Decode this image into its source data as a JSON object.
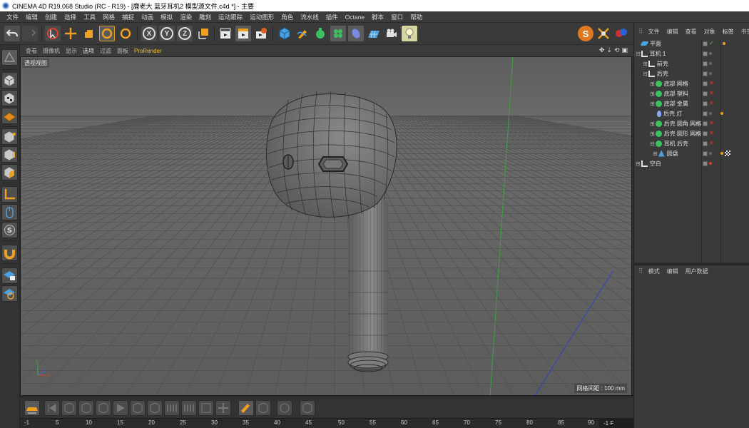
{
  "window": {
    "title": "CINEMA 4D R19.068 Studio (RC - R19) - [鹿老大 蓝牙耳机2 模型源文件.c4d *] - 主要"
  },
  "menubar": {
    "items": [
      "文件",
      "编辑",
      "创建",
      "选择",
      "工具",
      "网格",
      "捕捉",
      "动画",
      "模拟",
      "渲染",
      "雕刻",
      "运动跟踪",
      "运动图形",
      "角色",
      "流水线",
      "插件",
      "Octane",
      "脚本",
      "窗口",
      "帮助"
    ]
  },
  "toolbar": {
    "undo_icon": "undo-icon",
    "axis_x": "X",
    "axis_y": "Y",
    "axis_z": "Z"
  },
  "viewport": {
    "menus": [
      "查看",
      "摄像机",
      "显示",
      "选项",
      "过滤",
      "面板",
      "ProRender"
    ],
    "label": "透视视图",
    "grid_spacing": "网格间距 : 100 mm"
  },
  "timeline": {
    "ticks": [
      "-1",
      "5",
      "10",
      "15",
      "20",
      "25",
      "30",
      "35",
      "40",
      "45",
      "50",
      "55",
      "60",
      "65",
      "70",
      "75",
      "80",
      "85",
      "90"
    ],
    "frame_field": "-1 F"
  },
  "object_manager": {
    "menus": [
      "文件",
      "编辑",
      "查看",
      "对象",
      "标签",
      "书签"
    ],
    "objects": [
      {
        "name": "平面",
        "icon": "plane-icon",
        "color": "#4aa0e0"
      },
      {
        "name": "耳机 1",
        "icon": "null-object-icon",
        "color": "#e0e0e0"
      },
      {
        "name": "前壳",
        "icon": "null-object-icon",
        "color": "#e0e0e0"
      },
      {
        "name": "后壳",
        "icon": "null-object-icon",
        "color": "#e0e0e0"
      },
      {
        "name": "底部 网格",
        "icon": "subdivision-icon",
        "color": "#3cc060"
      },
      {
        "name": "底部 塑料",
        "icon": "subdivision-icon",
        "color": "#3cc060"
      },
      {
        "name": "底部 金属",
        "icon": "subdivision-icon",
        "color": "#3cc060"
      },
      {
        "name": "后壳 灯",
        "icon": "light-icon",
        "color": "#8aa8ff"
      },
      {
        "name": "后壳 圆角 网格",
        "icon": "subdivision-icon",
        "color": "#3cc060"
      },
      {
        "name": "后壳 圆形 网格",
        "icon": "subdivision-icon",
        "color": "#3cc060"
      },
      {
        "name": "耳机 后壳",
        "icon": "subdivision-icon",
        "color": "#3cc060"
      },
      {
        "name": "圆盘",
        "icon": "disc-icon",
        "color": "#4aa0e0"
      },
      {
        "name": "空白",
        "icon": "null-object-icon",
        "color": "#e0e0e0"
      }
    ]
  },
  "attribute_manager": {
    "menus": [
      "模式",
      "编辑",
      "用户数据"
    ]
  }
}
